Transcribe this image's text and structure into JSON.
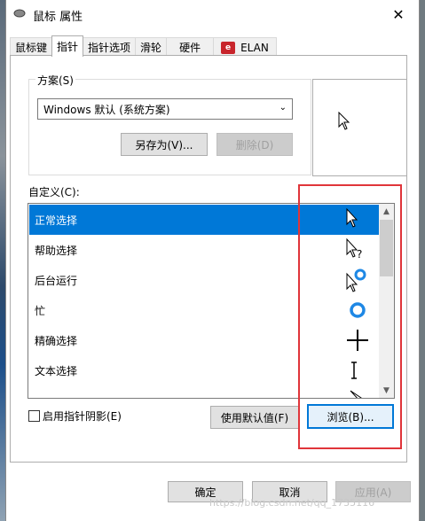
{
  "window": {
    "title": "鼠标 属性",
    "close": "✕"
  },
  "tabs": [
    {
      "label": "鼠标键"
    },
    {
      "label": "指针"
    },
    {
      "label": "指针选项"
    },
    {
      "label": "滑轮"
    },
    {
      "label": "硬件"
    },
    {
      "label": "ELAN"
    }
  ],
  "scheme": {
    "label": "方案(S)",
    "selected": "Windows 默认 (系统方案)",
    "save_as": "另存为(V)...",
    "delete": "删除(D)"
  },
  "customize": {
    "label": "自定义(C):",
    "items": [
      {
        "label": "正常选择",
        "cursor": "arrow-cursor-icon"
      },
      {
        "label": "帮助选择",
        "cursor": "help-cursor-icon"
      },
      {
        "label": "后台运行",
        "cursor": "working-cursor-icon"
      },
      {
        "label": "忙",
        "cursor": "busy-cursor-icon"
      },
      {
        "label": "精确选择",
        "cursor": "crosshair-cursor-icon"
      },
      {
        "label": "文本选择",
        "cursor": "text-cursor-icon"
      }
    ]
  },
  "shadow_checkbox": "启用指针阴影(E)",
  "use_default": "使用默认值(F)",
  "browse": "浏览(B)...",
  "buttons": {
    "ok": "确定",
    "cancel": "取消",
    "apply": "应用(A)"
  },
  "watermark": "https://blog.csdn.net/qq_1735116",
  "colors": {
    "accent": "#0078d7",
    "highlight_box": "#e0353a"
  }
}
